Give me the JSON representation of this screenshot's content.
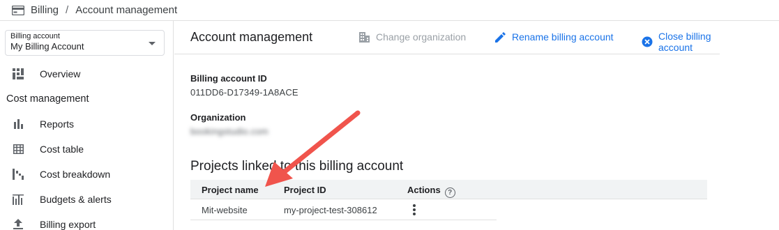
{
  "breadcrumb": {
    "root": "Billing",
    "separator": "/",
    "current": "Account management"
  },
  "sidebar": {
    "account_select": {
      "label": "Billing account",
      "value": "My Billing Account"
    },
    "overview": "Overview",
    "section": "Cost management",
    "items": [
      {
        "label": "Reports",
        "icon": "bar-chart-icon"
      },
      {
        "label": "Cost table",
        "icon": "table-icon"
      },
      {
        "label": "Cost breakdown",
        "icon": "waterfall-icon"
      },
      {
        "label": "Budgets & alerts",
        "icon": "budget-icon"
      },
      {
        "label": "Billing export",
        "icon": "upload-icon"
      }
    ]
  },
  "main": {
    "title": "Account management",
    "actions": {
      "change_org": "Change organization",
      "rename": "Rename billing account",
      "close": "Close billing account"
    },
    "billing_id_label": "Billing account ID",
    "billing_id_value": "011DD6-D17349-1A8ACE",
    "org_label": "Organization",
    "org_value": "bookingstudio.com",
    "projects_title": "Projects linked to this billing account",
    "table": {
      "headers": {
        "name": "Project name",
        "id": "Project ID",
        "actions": "Actions"
      },
      "rows": [
        {
          "name": "Mit-website",
          "id": "my-project-test-308612"
        }
      ]
    }
  },
  "colors": {
    "link": "#1a73e8",
    "arrow": "#f0544c"
  }
}
